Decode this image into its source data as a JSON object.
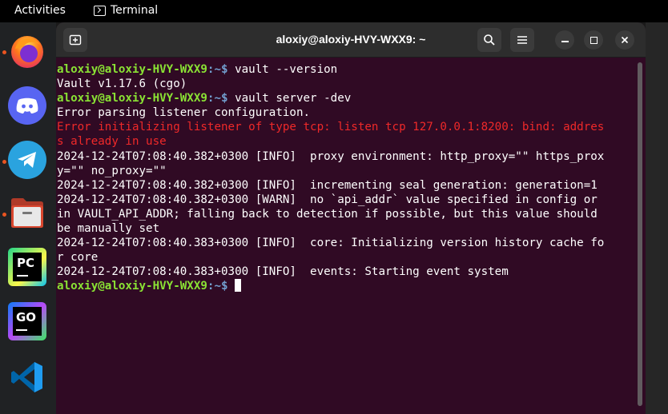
{
  "topbar": {
    "activities": "Activities",
    "app_name": "Terminal"
  },
  "dock": {
    "items": [
      {
        "name": "firefox",
        "running": true
      },
      {
        "name": "discord",
        "running": false
      },
      {
        "name": "telegram",
        "running": true
      },
      {
        "name": "files",
        "running": true
      },
      {
        "name": "pycharm",
        "label": "PC",
        "running": false
      },
      {
        "name": "goland",
        "label": "GO",
        "running": false
      },
      {
        "name": "vscode",
        "running": false
      }
    ]
  },
  "window": {
    "title": "aloxiy@aloxiy-HVY-WXX9: ~"
  },
  "terminal": {
    "prompt_user": "aloxiy@aloxiy-HVY-WXX9",
    "prompt_path": ":~$",
    "lines": [
      {
        "type": "prompt",
        "cmd": " vault --version"
      },
      {
        "type": "out",
        "text": "Vault v1.17.6 (cgo)"
      },
      {
        "type": "prompt",
        "cmd": " vault server -dev"
      },
      {
        "type": "out",
        "text": "Error parsing listener configuration."
      },
      {
        "type": "err",
        "text": "Error initializing listener of type tcp: listen tcp 127.0.0.1:8200: bind: addres"
      },
      {
        "type": "err",
        "text": "s already in use"
      },
      {
        "type": "out",
        "text": "2024-12-24T07:08:40.382+0300 [INFO]  proxy environment: http_proxy=\"\" https_prox"
      },
      {
        "type": "out",
        "text": "y=\"\" no_proxy=\"\""
      },
      {
        "type": "out",
        "text": "2024-12-24T07:08:40.382+0300 [INFO]  incrementing seal generation: generation=1"
      },
      {
        "type": "out",
        "text": "2024-12-24T07:08:40.382+0300 [WARN]  no `api_addr` value specified in config or"
      },
      {
        "type": "out",
        "text": "in VAULT_API_ADDR; falling back to detection if possible, but this value should"
      },
      {
        "type": "out",
        "text": "be manually set"
      },
      {
        "type": "out",
        "text": "2024-12-24T07:08:40.383+0300 [INFO]  core: Initializing version history cache fo"
      },
      {
        "type": "out",
        "text": "r core"
      },
      {
        "type": "out",
        "text": "2024-12-24T07:08:40.383+0300 [INFO]  events: Starting event system"
      },
      {
        "type": "prompt",
        "cmd": " ",
        "cursor": true
      }
    ]
  },
  "colors": {
    "terminal_bg": "#300a24",
    "prompt_user": "#8ae234",
    "prompt_path": "#729fcf",
    "error": "#ef2929",
    "accent_dot": "#e95420"
  }
}
